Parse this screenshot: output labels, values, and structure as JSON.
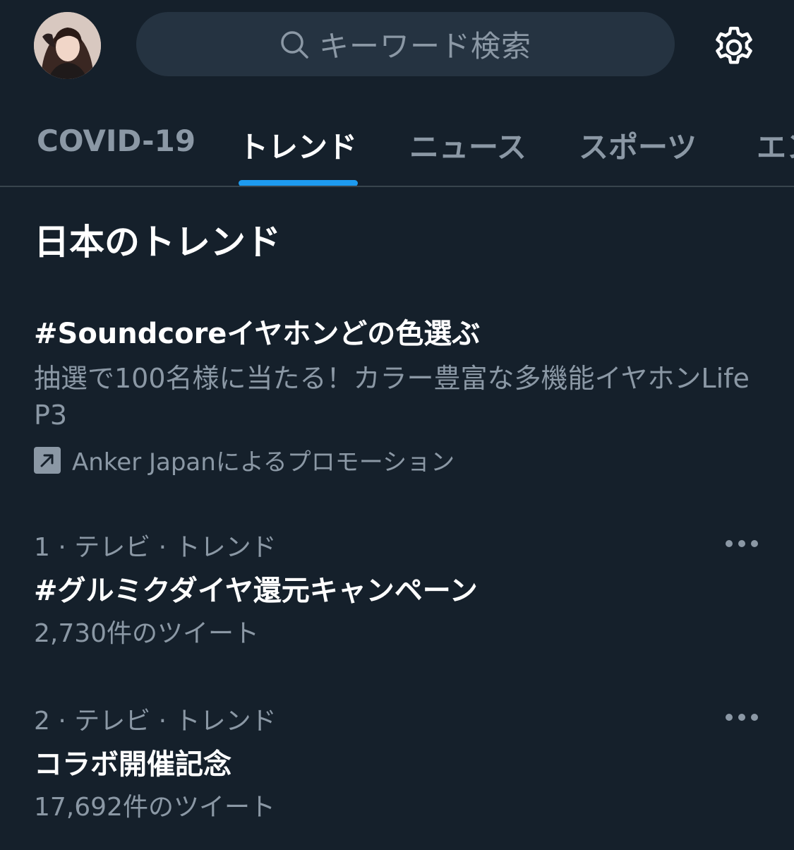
{
  "header": {
    "search_placeholder": "キーワード検索"
  },
  "tabs": [
    {
      "label": "COVID-19",
      "active": false
    },
    {
      "label": "トレンド",
      "active": true
    },
    {
      "label": "ニュース",
      "active": false
    },
    {
      "label": "スポーツ",
      "active": false
    },
    {
      "label": "エン",
      "active": false
    }
  ],
  "section": {
    "title": "日本のトレンド"
  },
  "promoted": {
    "title": "#Soundcoreイヤホンどの色選ぶ",
    "description": "抽選で100名様に当たる！カラー豊富な多機能イヤホンLife P3",
    "promoted_by": "Anker Japanによるプロモーション"
  },
  "trends": [
    {
      "meta": "1 · テレビ · トレンド",
      "name": "#グルミクダイヤ還元キャンペーン",
      "count": "2,730件のツイート"
    },
    {
      "meta": "2 · テレビ · トレンド",
      "name": "コラボ開催記念",
      "count": "17,692件のツイート"
    }
  ],
  "colors": {
    "background": "#15202b",
    "search_bg": "#253341",
    "secondary_text": "#8b98a5",
    "accent": "#1d9bf0",
    "divider": "#38444d"
  }
}
